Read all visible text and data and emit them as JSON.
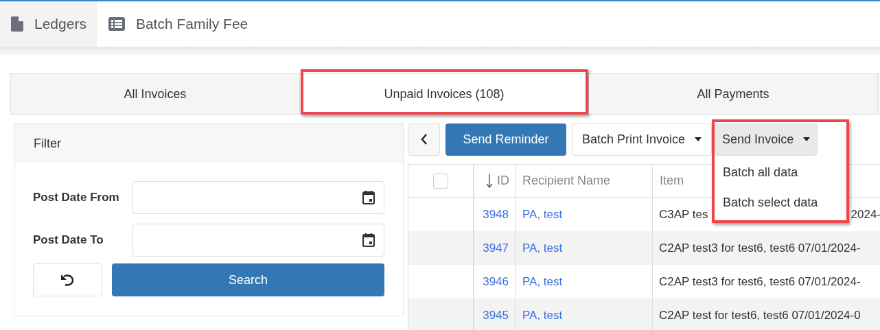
{
  "top_tabs": [
    {
      "label": "Ledgers",
      "selected": true
    },
    {
      "label": "Batch Family Fee",
      "selected": false
    }
  ],
  "tabs": [
    {
      "label": "All Invoices",
      "selected": false,
      "annotated": false
    },
    {
      "label": "Unpaid Invoices (108)",
      "selected": true,
      "annotated": true
    },
    {
      "label": "All Payments",
      "selected": false,
      "annotated": false
    }
  ],
  "filter": {
    "title": "Filter",
    "fields": [
      {
        "label": "Post Date From"
      },
      {
        "label": "Post Date To"
      }
    ],
    "search_button": "Search"
  },
  "toolbar": {
    "reminder_button": "Send Reminder",
    "print_button": "Batch Print Invoice",
    "send_button": "Send Invoice",
    "send_menu_open": true,
    "send_annotated": true,
    "send_menu": [
      "Batch all data",
      "Batch select data"
    ]
  },
  "table": {
    "columns": [
      "ID",
      "Recipient Name",
      "Item"
    ],
    "all_checked": false,
    "rows": [
      {
        "id": "3948",
        "recipient": "PA, test",
        "item": "C3AP tes",
        "item_tail": "2024-"
      },
      {
        "id": "3947",
        "recipient": "PA, test",
        "item": "C2AP test3 for test6, test6 07/01/2024-"
      },
      {
        "id": "3946",
        "recipient": "PA, test",
        "item": "C2AP test3 for test6, test6 07/01/2024-"
      },
      {
        "id": "3945",
        "recipient": "PA, test",
        "item": "C2AP test for test6, test6 07/01/2024-0"
      }
    ]
  }
}
